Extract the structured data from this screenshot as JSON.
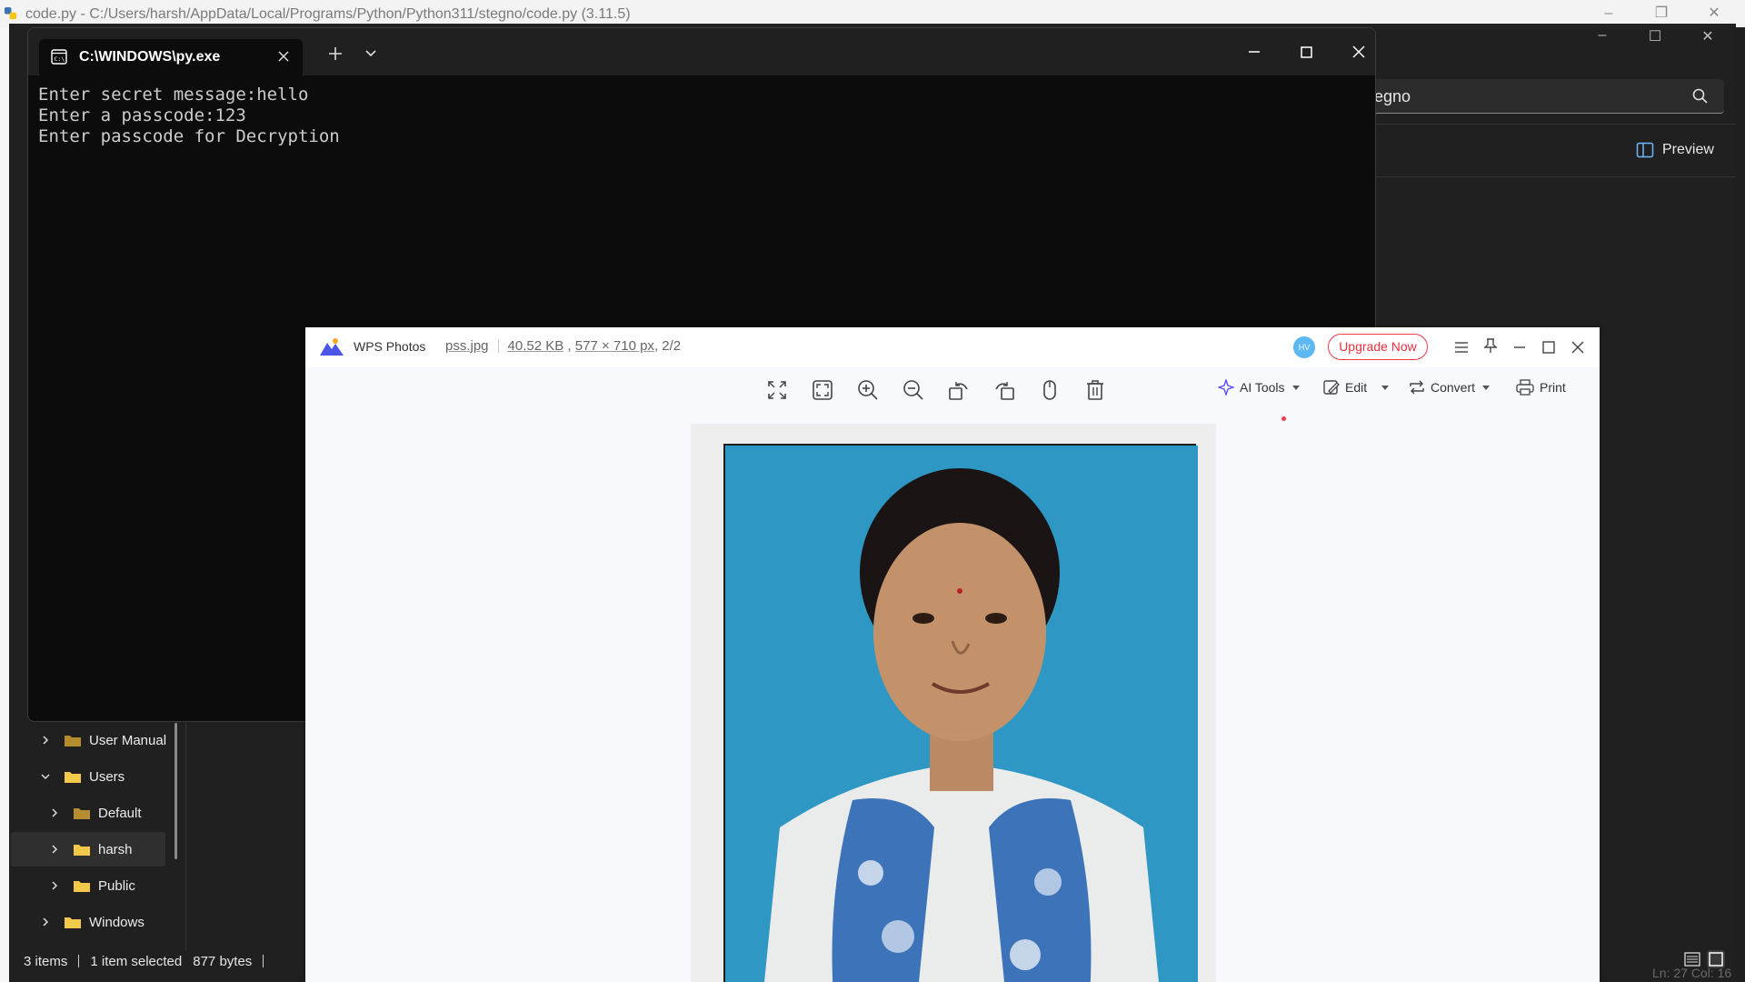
{
  "idle": {
    "title": "code.py - C:/Users/harsh/AppData/Local/Programs/Python/Python311/stegno/code.py (3.11.5)",
    "controls": [
      "–",
      "❐",
      "✕"
    ]
  },
  "explorer": {
    "controls": [
      "–",
      "☐",
      "✕"
    ],
    "search_value": "egno",
    "preview_label": "Preview",
    "tree": [
      {
        "label": "User Manual",
        "expanded": false
      },
      {
        "label": "Users",
        "expanded": true
      },
      {
        "label": "Default",
        "expanded": false
      },
      {
        "label": "harsh",
        "expanded": false,
        "selected": true
      },
      {
        "label": "Public",
        "expanded": false
      },
      {
        "label": "Windows",
        "expanded": false
      }
    ],
    "status": {
      "items": "3 items",
      "selected": "1 item selected",
      "size": "877 bytes"
    },
    "corner_text": "Ln: 27   Col: 16"
  },
  "terminal": {
    "tab_title": "C:\\WINDOWS\\py.exe",
    "lines": [
      "Enter secret message:hello",
      "Enter a passcode:123",
      "Enter passcode for Decryption"
    ]
  },
  "wps": {
    "app_name": "WPS Photos",
    "file_name": "pss.jpg",
    "file_size": "40.52 KB",
    "dimensions": "577 × 710 px",
    "index": "2/2",
    "avatar_initials": "HV",
    "upgrade_label": "Upgrade Now",
    "toolbar": {
      "ai_tools": "AI Tools",
      "edit": "Edit",
      "convert": "Convert",
      "print": "Print"
    },
    "colors": {
      "accent_red": "#f03b4a",
      "photo_bg": "#2f97c4"
    }
  }
}
